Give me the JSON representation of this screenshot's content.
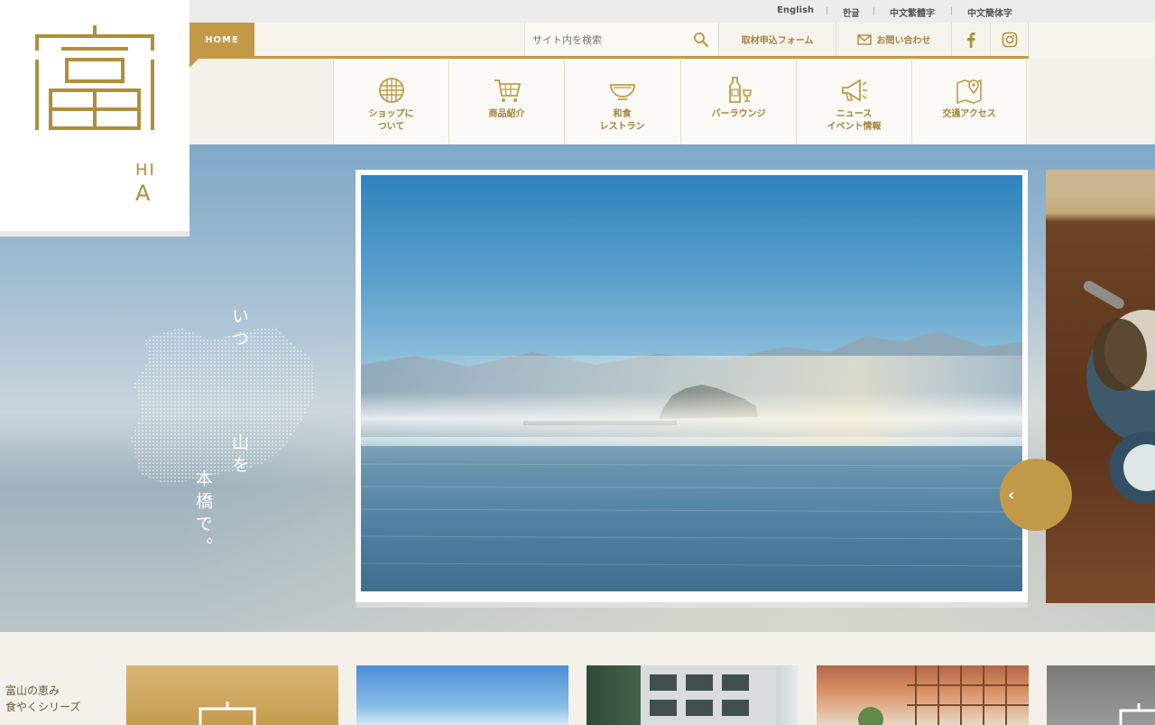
{
  "languages": [
    "English",
    "한글",
    "中文繁體字",
    "中文簡体字"
  ],
  "header": {
    "home_label": "HOME",
    "search_placeholder": "サイト内を検索",
    "press_form_label": "取材申込フォーム",
    "contact_label": "お問い合わせ"
  },
  "nav": [
    {
      "label": "ショップに\nついて",
      "icon": "globe-grid-icon"
    },
    {
      "label": "商品紹介",
      "icon": "shopping-cart-icon"
    },
    {
      "label": "和食\nレストラン",
      "icon": "rice-bowl-icon"
    },
    {
      "label": "バーラウンジ",
      "icon": "sake-bottle-icon"
    },
    {
      "label": "ニュース\nイベント情報",
      "icon": "megaphone-icon"
    },
    {
      "label": "交通アクセス",
      "icon": "map-pin-icon"
    }
  ],
  "logo": {
    "kanji": "富",
    "text_line_1": "HI",
    "text_line_2": "A"
  },
  "hero": {
    "tagline_col_1": "いつ",
    "tagline_col_2": "山を",
    "tagline_col_3": "本橋で。"
  },
  "bottom": {
    "series_text": "富山の恵み\n食やくシリーズ"
  },
  "colors": {
    "gold": "#c29a47",
    "accent_text": "#a4823a"
  }
}
